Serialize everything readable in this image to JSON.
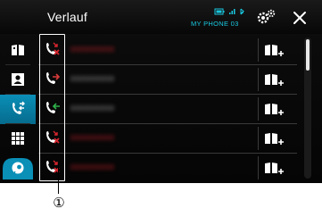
{
  "header": {
    "title": "Verlauf",
    "device_name": "MY PHONE 03",
    "status_icons": [
      "battery-icon",
      "signal-icon",
      "bluetooth-icon"
    ],
    "settings_icon": "settings-icon",
    "close_icon": "close-icon"
  },
  "sidebar": {
    "items": [
      {
        "name": "phonebook",
        "icon": "phonebook-icon",
        "active": false
      },
      {
        "name": "contacts",
        "icon": "contact-card-icon",
        "active": false
      },
      {
        "name": "call-history",
        "icon": "call-history-icon",
        "active": true
      },
      {
        "name": "keypad",
        "icon": "keypad-icon",
        "active": false
      },
      {
        "name": "voice-recognition",
        "icon": "voice-recognition-icon",
        "active": false
      }
    ]
  },
  "call_list": {
    "rows": [
      {
        "type": "missed",
        "icon": "missed-call-icon",
        "number": "0000000000"
      },
      {
        "type": "outgoing",
        "icon": "outgoing-call-icon",
        "number": "0000000000"
      },
      {
        "type": "incoming",
        "icon": "incoming-call-icon",
        "number": "0000000000"
      },
      {
        "type": "missed",
        "icon": "missed-call-icon",
        "number": "0000000000"
      },
      {
        "type": "missed",
        "icon": "missed-call-icon",
        "number": "0000000000"
      }
    ],
    "add_icon": "add-to-phonebook-icon"
  },
  "scrollbar": {
    "position_fraction": 0.0
  },
  "callout": {
    "label": "①"
  },
  "colors": {
    "accent": "#0a8fb7",
    "device_name": "#19c8e0",
    "missed": "#c0202a",
    "outgoing": "#d83a3a",
    "incoming": "#2fb04a"
  }
}
